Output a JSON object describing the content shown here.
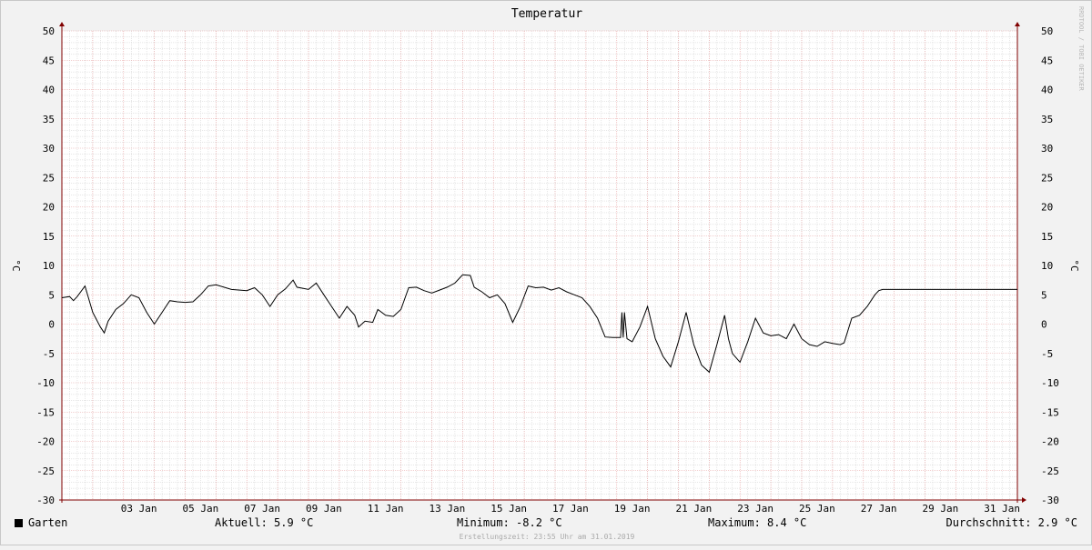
{
  "chart_data": {
    "type": "line",
    "title": "Temperatur",
    "ylabel": "°C",
    "ylim": [
      -30,
      50
    ],
    "yticks": [
      50,
      45,
      40,
      35,
      30,
      25,
      20,
      15,
      10,
      5,
      0,
      -5,
      -10,
      -15,
      -20,
      -25,
      -30
    ],
    "xlim": [
      "2019-01-01T00:00",
      "2019-01-31T23:55"
    ],
    "xticks": [
      {
        "t": "2019-01-03T12:00",
        "label": "03 Jan"
      },
      {
        "t": "2019-01-05T12:00",
        "label": "05 Jan"
      },
      {
        "t": "2019-01-07T12:00",
        "label": "07 Jan"
      },
      {
        "t": "2019-01-09T12:00",
        "label": "09 Jan"
      },
      {
        "t": "2019-01-11T12:00",
        "label": "11 Jan"
      },
      {
        "t": "2019-01-13T12:00",
        "label": "13 Jan"
      },
      {
        "t": "2019-01-15T12:00",
        "label": "15 Jan"
      },
      {
        "t": "2019-01-17T12:00",
        "label": "17 Jan"
      },
      {
        "t": "2019-01-19T12:00",
        "label": "19 Jan"
      },
      {
        "t": "2019-01-21T12:00",
        "label": "21 Jan"
      },
      {
        "t": "2019-01-23T12:00",
        "label": "23 Jan"
      },
      {
        "t": "2019-01-25T12:00",
        "label": "25 Jan"
      },
      {
        "t": "2019-01-27T12:00",
        "label": "27 Jan"
      },
      {
        "t": "2019-01-29T12:00",
        "label": "29 Jan"
      },
      {
        "t": "2019-01-31T12:00",
        "label": "31 Jan"
      }
    ],
    "grid": true,
    "series": [
      {
        "name": "Garten",
        "color": "#000000",
        "points": [
          [
            "2019-01-01T00:00",
            4.5
          ],
          [
            "2019-01-01T06:00",
            4.7
          ],
          [
            "2019-01-01T09:00",
            4.0
          ],
          [
            "2019-01-01T12:00",
            4.7
          ],
          [
            "2019-01-01T18:00",
            6.5
          ],
          [
            "2019-01-02T00:00",
            2.0
          ],
          [
            "2019-01-02T06:00",
            -0.5
          ],
          [
            "2019-01-02T09:00",
            -1.5
          ],
          [
            "2019-01-02T12:00",
            0.5
          ],
          [
            "2019-01-02T18:00",
            2.5
          ],
          [
            "2019-01-03T00:00",
            3.5
          ],
          [
            "2019-01-03T06:00",
            5.0
          ],
          [
            "2019-01-03T12:00",
            4.5
          ],
          [
            "2019-01-03T18:00",
            2.0
          ],
          [
            "2019-01-04T00:00",
            0.0
          ],
          [
            "2019-01-04T06:00",
            2.0
          ],
          [
            "2019-01-04T12:00",
            4.0
          ],
          [
            "2019-01-04T18:00",
            3.8
          ],
          [
            "2019-01-05T00:00",
            3.7
          ],
          [
            "2019-01-05T06:00",
            3.8
          ],
          [
            "2019-01-05T12:00",
            5.0
          ],
          [
            "2019-01-05T18:00",
            6.5
          ],
          [
            "2019-01-06T00:00",
            6.7
          ],
          [
            "2019-01-06T12:00",
            5.9
          ],
          [
            "2019-01-07T00:00",
            5.7
          ],
          [
            "2019-01-07T06:00",
            6.2
          ],
          [
            "2019-01-07T12:00",
            5.0
          ],
          [
            "2019-01-07T18:00",
            3.0
          ],
          [
            "2019-01-08T00:00",
            5.0
          ],
          [
            "2019-01-08T06:00",
            6.0
          ],
          [
            "2019-01-08T12:00",
            7.5
          ],
          [
            "2019-01-08T15:00",
            6.3
          ],
          [
            "2019-01-09T00:00",
            5.9
          ],
          [
            "2019-01-09T06:00",
            7.0
          ],
          [
            "2019-01-09T12:00",
            5.0
          ],
          [
            "2019-01-09T18:00",
            3.0
          ],
          [
            "2019-01-10T00:00",
            1.0
          ],
          [
            "2019-01-10T06:00",
            3.0
          ],
          [
            "2019-01-10T12:00",
            1.5
          ],
          [
            "2019-01-10T15:00",
            -0.5
          ],
          [
            "2019-01-10T20:00",
            0.5
          ],
          [
            "2019-01-11T02:00",
            0.3
          ],
          [
            "2019-01-11T06:00",
            2.5
          ],
          [
            "2019-01-11T12:00",
            1.5
          ],
          [
            "2019-01-11T18:00",
            1.3
          ],
          [
            "2019-01-12T00:00",
            2.5
          ],
          [
            "2019-01-12T06:00",
            6.2
          ],
          [
            "2019-01-12T12:00",
            6.3
          ],
          [
            "2019-01-12T18:00",
            5.7
          ],
          [
            "2019-01-13T00:00",
            5.3
          ],
          [
            "2019-01-13T06:00",
            5.8
          ],
          [
            "2019-01-13T12:00",
            6.3
          ],
          [
            "2019-01-13T18:00",
            7.0
          ],
          [
            "2019-01-14T00:00",
            8.4
          ],
          [
            "2019-01-14T06:00",
            8.3
          ],
          [
            "2019-01-14T09:00",
            6.3
          ],
          [
            "2019-01-14T15:00",
            5.5
          ],
          [
            "2019-01-14T21:00",
            4.5
          ],
          [
            "2019-01-15T03:00",
            5.0
          ],
          [
            "2019-01-15T09:00",
            3.5
          ],
          [
            "2019-01-15T15:00",
            0.3
          ],
          [
            "2019-01-15T21:00",
            3.0
          ],
          [
            "2019-01-16T03:00",
            6.5
          ],
          [
            "2019-01-16T09:00",
            6.2
          ],
          [
            "2019-01-16T15:00",
            6.3
          ],
          [
            "2019-01-16T21:00",
            5.8
          ],
          [
            "2019-01-17T03:00",
            6.2
          ],
          [
            "2019-01-17T09:00",
            5.5
          ],
          [
            "2019-01-17T15:00",
            5.0
          ],
          [
            "2019-01-17T21:00",
            4.5
          ],
          [
            "2019-01-18T03:00",
            3.0
          ],
          [
            "2019-01-18T09:00",
            1.0
          ],
          [
            "2019-01-18T15:00",
            -2.2
          ],
          [
            "2019-01-18T21:00",
            -2.3
          ],
          [
            "2019-01-19T03:00",
            -2.3
          ],
          [
            "2019-01-19T04:00",
            2.0
          ],
          [
            "2019-01-19T05:00",
            -2.3
          ],
          [
            "2019-01-19T06:00",
            2.0
          ],
          [
            "2019-01-19T08:00",
            -2.5
          ],
          [
            "2019-01-19T12:00",
            -3.0
          ],
          [
            "2019-01-19T18:00",
            -0.5
          ],
          [
            "2019-01-20T00:00",
            3.0
          ],
          [
            "2019-01-20T06:00",
            -2.5
          ],
          [
            "2019-01-20T12:00",
            -5.5
          ],
          [
            "2019-01-20T18:00",
            -7.3
          ],
          [
            "2019-01-21T00:00",
            -3.0
          ],
          [
            "2019-01-21T06:00",
            2.0
          ],
          [
            "2019-01-21T12:00",
            -3.5
          ],
          [
            "2019-01-21T18:00",
            -7.0
          ],
          [
            "2019-01-22T00:00",
            -8.2
          ],
          [
            "2019-01-22T06:00",
            -3.5
          ],
          [
            "2019-01-22T12:00",
            1.5
          ],
          [
            "2019-01-22T15:00",
            -2.5
          ],
          [
            "2019-01-22T18:00",
            -5.0
          ],
          [
            "2019-01-23T00:00",
            -6.5
          ],
          [
            "2019-01-23T06:00",
            -3.0
          ],
          [
            "2019-01-23T12:00",
            1.0
          ],
          [
            "2019-01-23T18:00",
            -1.5
          ],
          [
            "2019-01-24T00:00",
            -2.0
          ],
          [
            "2019-01-24T06:00",
            -1.8
          ],
          [
            "2019-01-24T12:00",
            -2.5
          ],
          [
            "2019-01-24T18:00",
            0.0
          ],
          [
            "2019-01-25T00:00",
            -2.5
          ],
          [
            "2019-01-25T06:00",
            -3.5
          ],
          [
            "2019-01-25T12:00",
            -3.8
          ],
          [
            "2019-01-25T18:00",
            -3.0
          ],
          [
            "2019-01-26T00:00",
            -3.3
          ],
          [
            "2019-01-26T06:00",
            -3.5
          ],
          [
            "2019-01-26T09:00",
            -3.2
          ],
          [
            "2019-01-26T15:00",
            1.0
          ],
          [
            "2019-01-26T21:00",
            1.5
          ],
          [
            "2019-01-27T03:00",
            3.0
          ],
          [
            "2019-01-27T09:00",
            5.0
          ],
          [
            "2019-01-27T12:00",
            5.7
          ],
          [
            "2019-01-27T15:00",
            5.9
          ],
          [
            "2019-01-31T23:55",
            5.9
          ]
        ]
      }
    ]
  },
  "legend": {
    "series_name": "Garten",
    "aktuell": "Aktuell: 5.9 °C",
    "minimum": "Minimum: -8.2 °C",
    "maximum": "Maximum: 8.4 °C",
    "durchschnitt": "Durchschnitt: 2.9 °C"
  },
  "footer": "Erstellungszeit: 23:55 Uhr am 31.01.2019",
  "watermark": "RRDTOOL / TOBI OETIKER",
  "colors": {
    "background": "#f2f2f2",
    "plot": "#ffffff",
    "minor_grid": "#cfcfcf",
    "major_grid": "#e6a2a2",
    "axis": "#800000",
    "line": "#000000"
  }
}
